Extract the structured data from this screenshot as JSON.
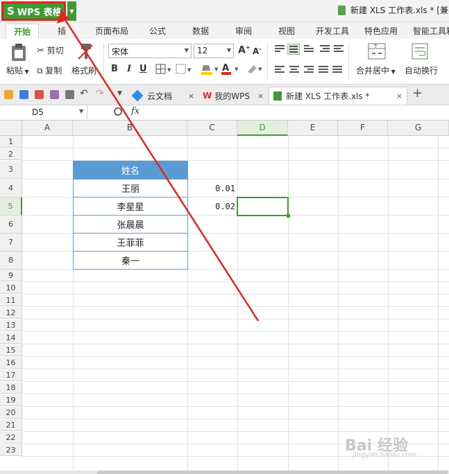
{
  "title_bar": {
    "app_button": "WPS 表格",
    "app_logo": "S",
    "document_title": "新建 XLS 工作表.xls * [兼容"
  },
  "menu": {
    "tabs": [
      "开始",
      "插",
      "页面布局",
      "公式",
      "数据",
      "审阅",
      "视图",
      "开发工具",
      "特色应用",
      "智能工具箱"
    ]
  },
  "ribbon": {
    "paste": "粘贴",
    "cut": "剪切",
    "copy": "复制",
    "format_painter": "格式刷",
    "font_name": "宋体",
    "font_size": "12",
    "bold": "B",
    "italic": "I",
    "underline": "U",
    "merge_center": "合并居中",
    "wrap_text": "自动换行",
    "font_color_accent": "#e4231c",
    "fill_color_accent": "#f5d000"
  },
  "doc_tabs": [
    {
      "label": "云文档"
    },
    {
      "label": "我的WPS"
    },
    {
      "label": "新建 XLS 工作表.xls *"
    }
  ],
  "formula_bar": {
    "cell_ref": "D5",
    "fx_label": "fx",
    "content": ""
  },
  "sheet": {
    "columns": [
      "A",
      "B",
      "C",
      "D",
      "E",
      "F",
      "G"
    ],
    "selected_column": "D",
    "rows": [
      "1",
      "2",
      "3",
      "4",
      "5",
      "6",
      "7",
      "8",
      "9",
      "10",
      "11",
      "12",
      "13",
      "14",
      "15",
      "16",
      "17",
      "18",
      "19",
      "20",
      "21",
      "22",
      "23"
    ],
    "selected_row": "5",
    "name_header": "姓名",
    "names": [
      "王丽",
      "李星星",
      "张晨晨",
      "王菲菲",
      "秦一"
    ],
    "c_values": [
      "0.01",
      "0.02"
    ],
    "header_color": "#5b9bd5",
    "accent_color": "#3f9a36"
  },
  "watermark": {
    "main": "Bai 经验",
    "sub": "jingyan.baidu.com"
  },
  "annotation": {
    "arrow_color": "#e4231c"
  }
}
